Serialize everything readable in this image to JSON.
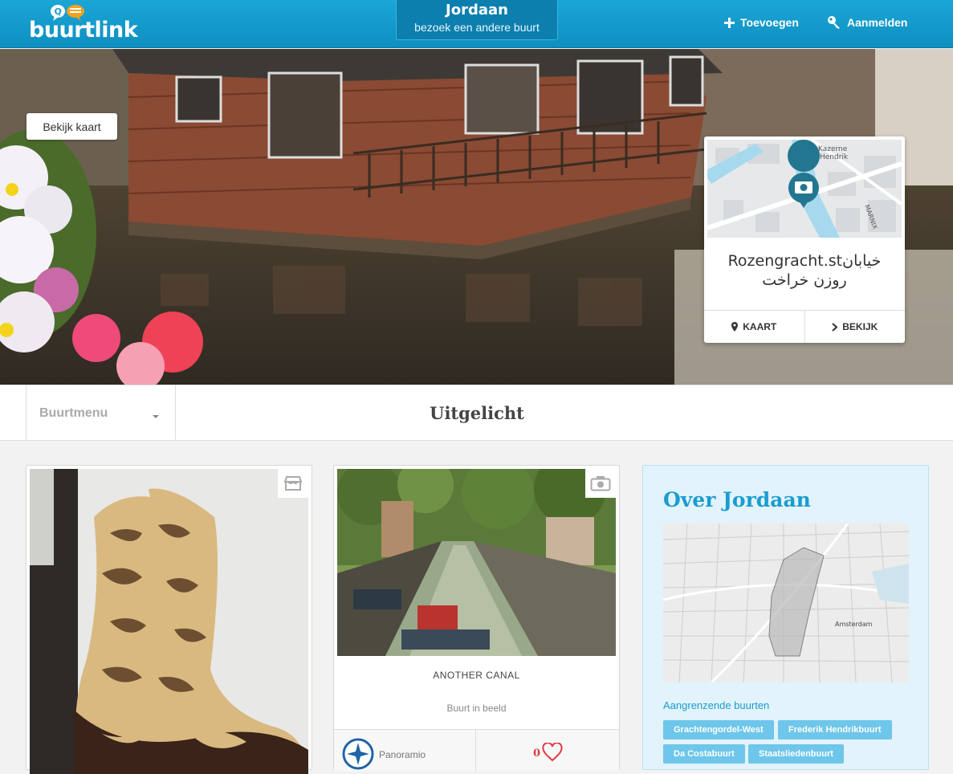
{
  "header": {
    "logo_text": "buurtlink",
    "neighborhood": "Jordaan",
    "neighborhood_sub": "bezoek een andere buurt",
    "add_label": "Toevoegen",
    "login_label": "Aanmelden",
    "colors": {
      "bar": "#1aa6d6",
      "bar_dark": "#0c7fae"
    }
  },
  "hero": {
    "map_button": "Bekijk kaart",
    "location_card": {
      "title_line1": "Rozengracht.stخیابان",
      "title_line2": "روزن خراخت",
      "map_labels": [
        "Kazerne",
        "Hendrik",
        "MARNIX"
      ],
      "map_action": "KAART",
      "view_action": "BEKIJK"
    }
  },
  "section": {
    "menu_label": "Buurtmenu",
    "title": "Uitgelicht"
  },
  "cards": [
    {
      "type_icon": "shop-icon",
      "image": "snakeskin cowboy boot"
    },
    {
      "type_icon": "camera-icon",
      "image": "canal with boats",
      "caption": "ANOTHER CANAL",
      "category": "Buurt in beeld",
      "source": "Panoramio",
      "likes": "0"
    }
  ],
  "over": {
    "title": "Over Jordaan",
    "map_label": "Amsterdam",
    "adjacent_label": "Aangrenzende buurten",
    "tags": [
      "Grachtengordel-West",
      "Frederik Hendrikbuurt",
      "Da Costabuurt",
      "Staatsliedenbuurt"
    ]
  }
}
